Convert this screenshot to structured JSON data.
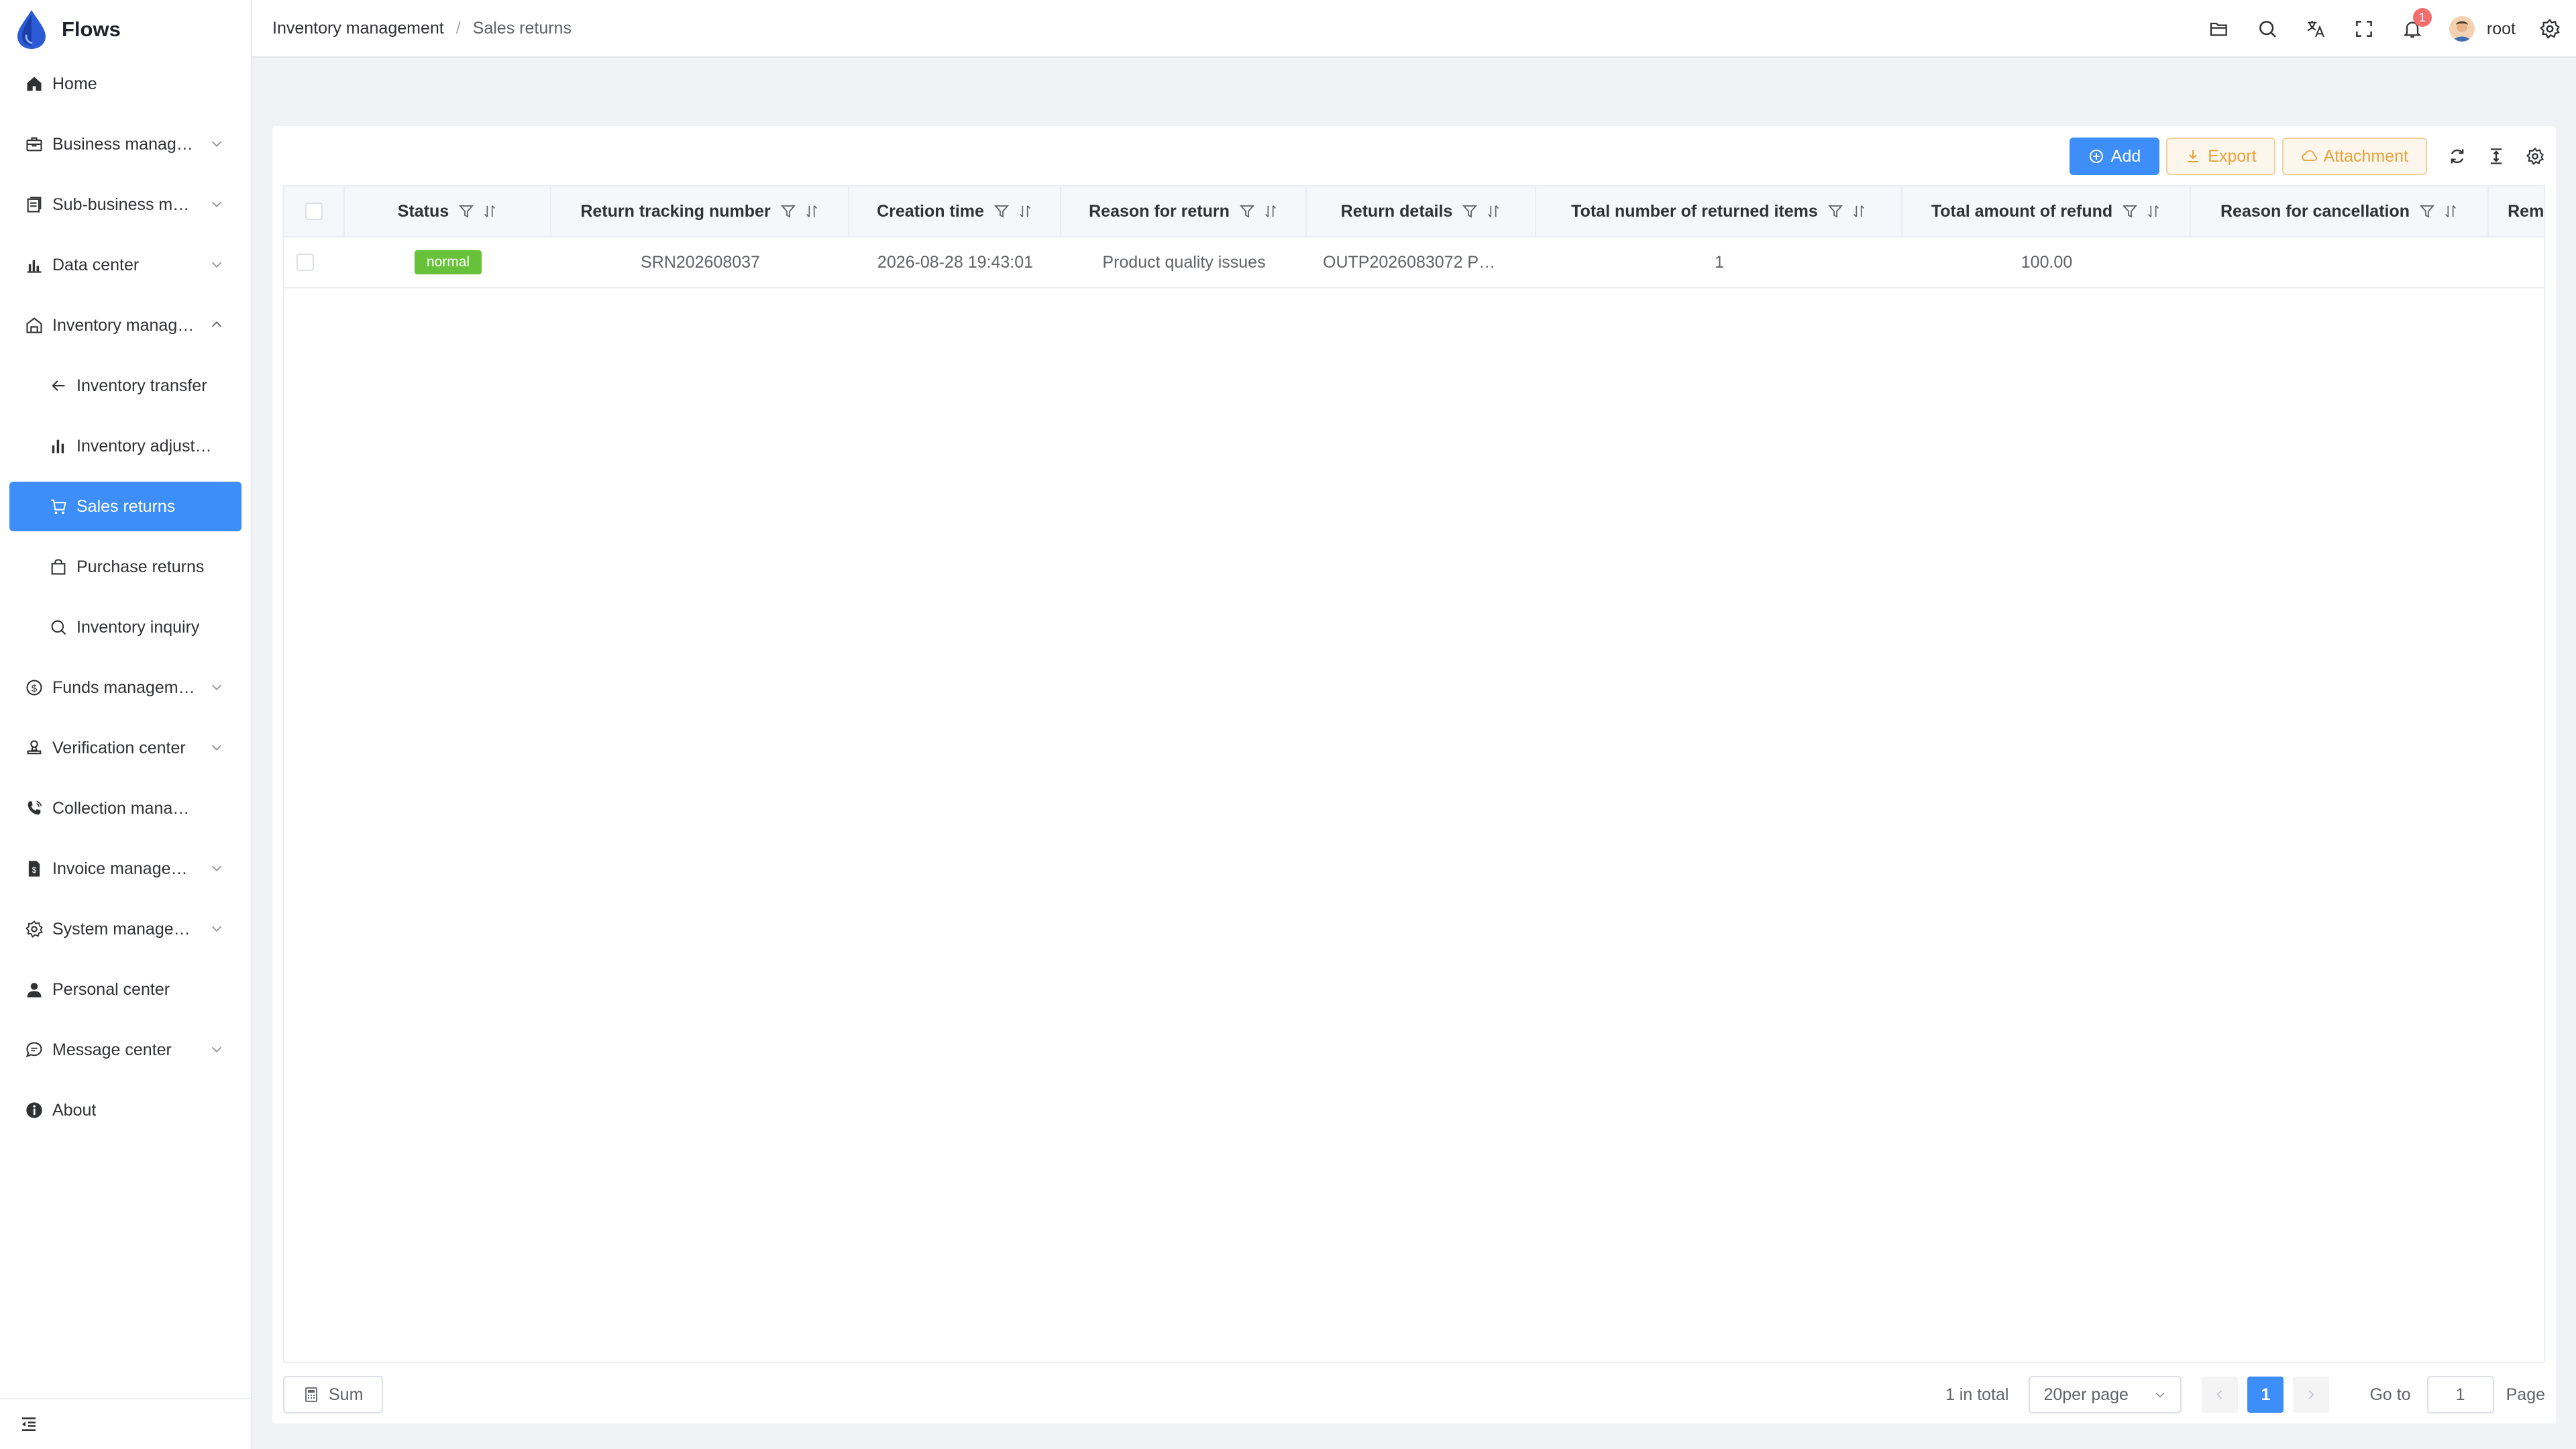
{
  "brand": {
    "name": "Flows"
  },
  "sidebar": {
    "items": [
      {
        "label": "Home",
        "icon": "home-icon"
      },
      {
        "label": "Business manag…",
        "icon": "briefcase-icon",
        "expandable": true
      },
      {
        "label": "Sub-business m…",
        "icon": "document-icon",
        "expandable": true
      },
      {
        "label": "Data center",
        "icon": "bar-chart-icon",
        "expandable": true
      },
      {
        "label": "Inventory manag…",
        "icon": "warehouse-icon",
        "expandable": true,
        "expanded": true
      },
      {
        "label": "Inventory transfer",
        "icon": "arrow-left-icon",
        "sub": true
      },
      {
        "label": "Inventory adjustm…",
        "icon": "bar-chart-icon",
        "sub": true
      },
      {
        "label": "Sales returns",
        "icon": "cart-icon",
        "sub": true,
        "active": true
      },
      {
        "label": "Purchase returns",
        "icon": "bag-icon",
        "sub": true
      },
      {
        "label": "Inventory inquiry",
        "icon": "search-icon",
        "sub": true
      },
      {
        "label": "Funds managem…",
        "icon": "coin-icon",
        "expandable": true
      },
      {
        "label": "Verification center",
        "icon": "stamp-icon",
        "expandable": true
      },
      {
        "label": "Collection managem…",
        "icon": "phone-icon"
      },
      {
        "label": "Invoice manage…",
        "icon": "invoice-icon",
        "expandable": true
      },
      {
        "label": "System manage…",
        "icon": "gear-icon",
        "expandable": true
      },
      {
        "label": "Personal center",
        "icon": "user-icon"
      },
      {
        "label": "Message center",
        "icon": "chat-icon",
        "expandable": true
      },
      {
        "label": "About",
        "icon": "info-icon"
      }
    ]
  },
  "breadcrumb": {
    "parent": "Inventory management",
    "separator": "/",
    "current": "Sales returns"
  },
  "header": {
    "notification_count": "1",
    "username": "root"
  },
  "toolbar": {
    "add_label": "Add",
    "export_label": "Export",
    "attachment_label": "Attachment"
  },
  "table": {
    "columns": [
      "Status",
      "Return tracking number",
      "Creation time",
      "Reason for return",
      "Return details",
      "Total number of returned items",
      "Total amount of refund",
      "Reason for cancellation",
      "Remark"
    ],
    "rows": [
      {
        "status": "normal",
        "tracking_number": "SRN202608037",
        "creation_time": "2026-08-28 19:43:01",
        "reason": "Product quality issues",
        "details": "OUTP2026083072 P…",
        "total_items": "1",
        "total_refund": "100.00",
        "cancel_reason": "",
        "remark": ""
      }
    ]
  },
  "footer": {
    "sum_label": "Sum",
    "total_text": "1 in total",
    "page_size": "20per page",
    "current_page": "1",
    "goto_label": "Go to",
    "goto_value": "1",
    "page_label": "Page"
  },
  "colors": {
    "accent": "#3d8ef8",
    "warning": "#e6a23c",
    "success": "#67c23a",
    "danger": "#f56c6c"
  }
}
